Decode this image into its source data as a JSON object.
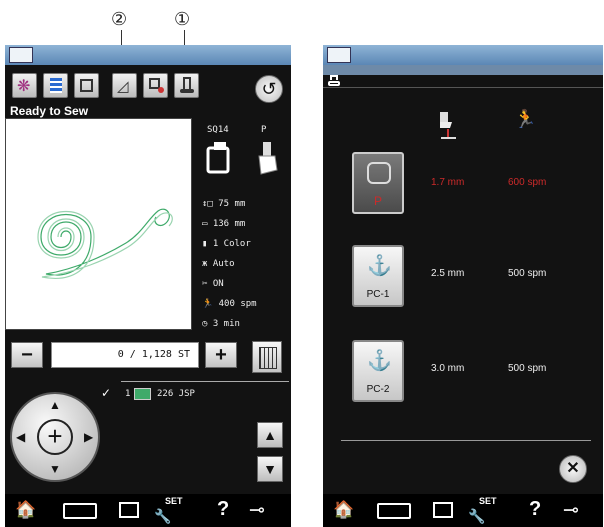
{
  "callouts": {
    "c2": "②",
    "c1": "①"
  },
  "left": {
    "status": "Ready to Sew",
    "hoop_label": "SQ14",
    "foot_label": "P",
    "specs": [
      {
        "icon": "↕□",
        "text": "75 mm"
      },
      {
        "icon": "▭",
        "text": "136 mm"
      },
      {
        "icon": "▮",
        "text": "1 Color"
      },
      {
        "icon": "ж",
        "text": "Auto"
      },
      {
        "icon": "✂",
        "text": "ON"
      },
      {
        "icon": "🏃",
        "text": "400 spm"
      },
      {
        "icon": "◷",
        "text": "3 min"
      }
    ],
    "stitch_counter": "0 / 1,128 ST",
    "minus": "−",
    "plus": "+",
    "color_index": "1",
    "color_code": "226 JSP",
    "back": "↺",
    "up": "▲",
    "down": "▼"
  },
  "right": {
    "rows": [
      {
        "label": "P",
        "height": "1.7 mm",
        "speed": "600 spm",
        "selected": true
      },
      {
        "label": "PC-1",
        "height": "2.5 mm",
        "speed": "500 spm",
        "selected": false
      },
      {
        "label": "PC-2",
        "height": "3.0 mm",
        "speed": "500 spm",
        "selected": false
      }
    ],
    "close": "✕"
  },
  "nav": {
    "home": "🏠",
    "set": "SET",
    "help": "?",
    "key": "⊸"
  },
  "colors": {
    "accent_red": "#cc2a2a",
    "thread_green": "#3faa6a"
  }
}
